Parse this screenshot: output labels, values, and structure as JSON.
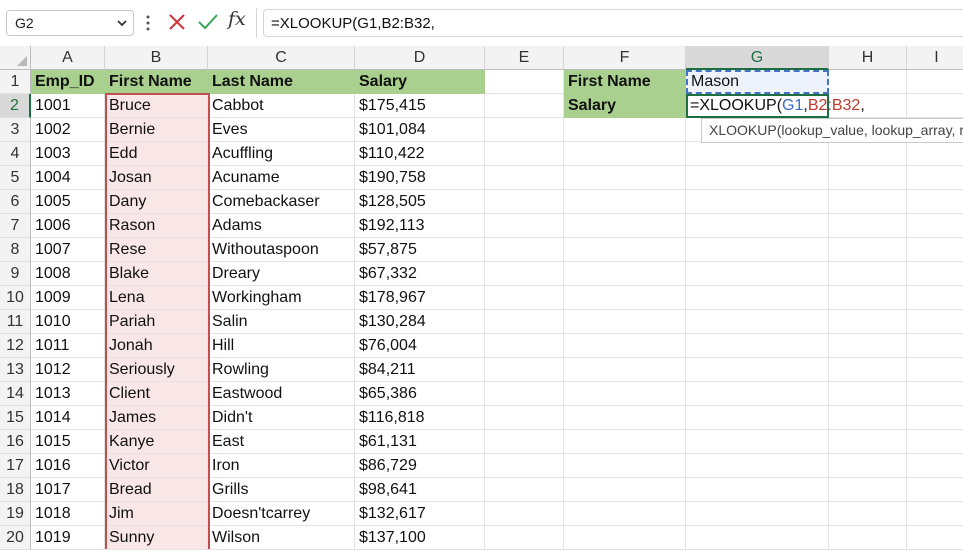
{
  "formula_bar": {
    "name_box": "G2",
    "formula": "=XLOOKUP(G1,B2:B32,",
    "fx_label": "fx",
    "icons": [
      "chevron-down-icon",
      "more-vertical-icon",
      "cancel-x-icon",
      "confirm-check-icon",
      "function-fx-icon"
    ]
  },
  "columns": [
    "A",
    "B",
    "C",
    "D",
    "E",
    "F",
    "G",
    "H",
    "I"
  ],
  "selected_column": "G",
  "selected_row": "2",
  "rows": [
    "1",
    "2",
    "3",
    "4",
    "5",
    "6",
    "7",
    "8",
    "9",
    "10",
    "11",
    "12",
    "13",
    "14",
    "15",
    "16",
    "17",
    "18",
    "19",
    "20"
  ],
  "table": {
    "headers": [
      "Emp_ID",
      "First Name",
      "Last Name",
      "Salary"
    ],
    "data": [
      [
        "1001",
        "Bruce",
        "Cabbot",
        "$175,415"
      ],
      [
        "1002",
        "Bernie",
        "Eves",
        "$101,084"
      ],
      [
        "1003",
        "Edd",
        "Acuffling",
        "$110,422"
      ],
      [
        "1004",
        "Josan",
        "Acuname",
        "$190,758"
      ],
      [
        "1005",
        "Dany",
        "Comebackaser",
        "$128,505"
      ],
      [
        "1006",
        "Rason",
        "Adams",
        "$192,113"
      ],
      [
        "1007",
        "Rese",
        "Withoutaspoon",
        "$57,875"
      ],
      [
        "1008",
        "Blake",
        "Dreary",
        "$67,332"
      ],
      [
        "1009",
        "Lena",
        "Workingham",
        "$178,967"
      ],
      [
        "1010",
        "Pariah",
        "Salin",
        "$130,284"
      ],
      [
        "1011",
        "Jonah",
        "Hill",
        "$76,004"
      ],
      [
        "1012",
        "Seriously",
        "Rowling",
        "$84,211"
      ],
      [
        "1013",
        "Client",
        "Eastwood",
        "$65,386"
      ],
      [
        "1014",
        "James",
        "Didn't",
        "$116,818"
      ],
      [
        "1015",
        "Kanye",
        "East",
        "$61,131"
      ],
      [
        "1016",
        "Victor",
        "Iron",
        "$86,729"
      ],
      [
        "1017",
        "Bread",
        "Grills",
        "$98,641"
      ],
      [
        "1018",
        "Jim",
        "Doesn'tcarrey",
        "$132,617"
      ],
      [
        "1019",
        "Sunny",
        "Wilson",
        "$137,100"
      ]
    ]
  },
  "lookup": {
    "f1_label": "First Name",
    "f2_label": "Salary",
    "g1_value": "Mason",
    "g2_prefix": "=XLOOKUP(",
    "g2_ref1": "G1",
    "g2_comma1": ",",
    "g2_ref2": "B2:B32",
    "g2_comma2": ",",
    "tooltip": "XLOOKUP(lookup_value, lookup_array, return_array, [if_not_found], [match_mode], [search_mode])"
  },
  "colors": {
    "header_fill": "#a9d08e",
    "range_highlight_border": "#c0504d",
    "range_highlight_fill": "#f9e6e6",
    "selection_green": "#1d6f42",
    "ref_blue": "#3a6dc4"
  }
}
